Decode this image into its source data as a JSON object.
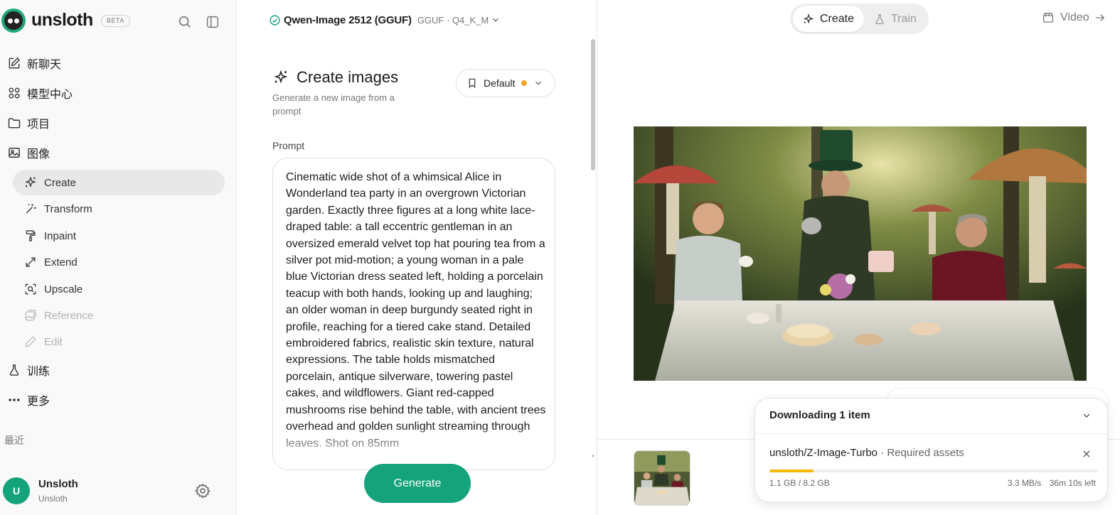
{
  "app": {
    "name": "unsloth",
    "badge": "BETA"
  },
  "sidebar": {
    "nav": [
      {
        "label": "新聊天",
        "icon": "edit-icon"
      },
      {
        "label": "模型中心",
        "icon": "grid-icon"
      },
      {
        "label": "项目",
        "icon": "folder-icon"
      },
      {
        "label": "图像",
        "icon": "image-icon"
      }
    ],
    "image_tools": [
      {
        "label": "Create",
        "icon": "sparkle-icon",
        "active": true
      },
      {
        "label": "Transform",
        "icon": "magic-wand-icon"
      },
      {
        "label": "Inpaint",
        "icon": "paint-roller-icon"
      },
      {
        "label": "Extend",
        "icon": "expand-icon"
      },
      {
        "label": "Upscale",
        "icon": "upscale-icon"
      },
      {
        "label": "Reference",
        "icon": "reference-icon",
        "disabled": true
      },
      {
        "label": "Edit",
        "icon": "pencil-icon",
        "disabled": true
      }
    ],
    "train_label": "训练",
    "more_label": "更多",
    "recent_label": "最近",
    "user": {
      "initial": "U",
      "name": "Unsloth",
      "sub": "Unsloth"
    }
  },
  "model_selector": {
    "name": "Qwen-Image 2512 (GGUF)",
    "meta": "GGUF · Q4_K_M"
  },
  "create": {
    "title": "Create images",
    "subtitle": "Generate a new image from a prompt",
    "preset": "Default",
    "prompt_label": "Prompt",
    "prompt": "Cinematic wide shot of a whimsical Alice in Wonderland tea party in an overgrown Victorian garden. Exactly three figures at a long white lace-draped table: a tall eccentric gentleman in an oversized emerald velvet top hat pouring tea from a silver pot mid-motion; a young woman in a pale blue Victorian dress seated left, holding a porcelain teacup with both hands, looking up and laughing; an older woman in deep burgundy seated right in profile, reaching for a tiered cake stand. Detailed embroidered fabrics, realistic skin texture, natural expressions. The table holds mismatched porcelain, antique silverware, towering pastel cakes, and wildflowers. Giant red-capped mushrooms rise behind the table, with ancient trees overhead and golden sunlight streaming through leaves. Shot on 85mm",
    "generate_label": "Generate"
  },
  "topbar": {
    "create_label": "Create",
    "train_label": "Train",
    "video_label": "Video"
  },
  "download": {
    "header": "Downloading 1 item",
    "item_name": "unsloth/Z-Image-Turbo",
    "item_note": "· Required assets",
    "progress": 0.135,
    "size": "1.1 GB / 8.2 GB",
    "speed": "3.3 MB/s",
    "eta": "36m 10s left"
  },
  "colors": {
    "accent": "#14a37a",
    "progress": "#f5b800",
    "preset_dot": "#f5a623"
  }
}
